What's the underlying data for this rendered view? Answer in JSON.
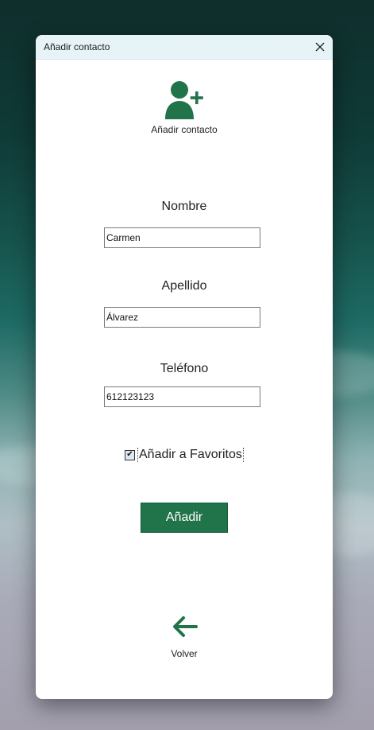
{
  "window": {
    "title": "Añadir contacto",
    "close_icon": "close-icon"
  },
  "header": {
    "icon": "add-user-icon",
    "label": "Añadir contacto"
  },
  "form": {
    "nombre": {
      "label": "Nombre",
      "value": "Carmen"
    },
    "apellido": {
      "label": "Apellido",
      "value": "Álvarez"
    },
    "telefono": {
      "label": "Teléfono",
      "value": "612123123"
    },
    "favoritos": {
      "label": "Añadir a Favoritos",
      "checked": true,
      "check_glyph": "✔"
    }
  },
  "actions": {
    "add_label": "Añadir",
    "back_icon": "arrow-left-icon",
    "back_label": "Volver"
  },
  "colors": {
    "accent": "#21734a",
    "titlebar_bg": "#e7f4f7"
  }
}
